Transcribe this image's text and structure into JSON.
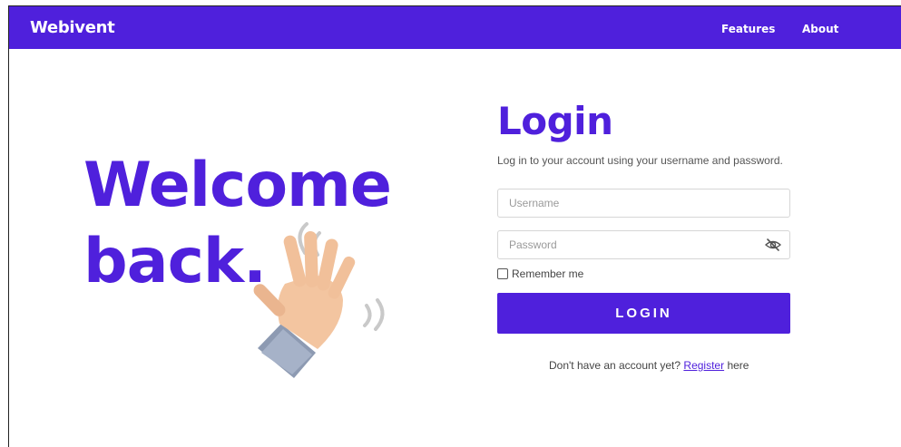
{
  "navbar": {
    "brand": "Webivent",
    "links": [
      "Features",
      "About"
    ],
    "background": "#4f20dc"
  },
  "hero": {
    "line1": "Welcome",
    "line2": "back.",
    "icon": "waving-hand-icon"
  },
  "login": {
    "title": "Login",
    "subtitle": "Log in to your account using your username and password.",
    "username_placeholder": "Username",
    "password_placeholder": "Password",
    "password_visibility_icon": "eye-slash-icon",
    "remember_label": "Remember me",
    "button_label": "LOGIN",
    "register_prefix": "Don't have an account yet?",
    "register_link": "Register",
    "register_suffix": "here"
  },
  "colors": {
    "accent": "#4f20dc"
  }
}
